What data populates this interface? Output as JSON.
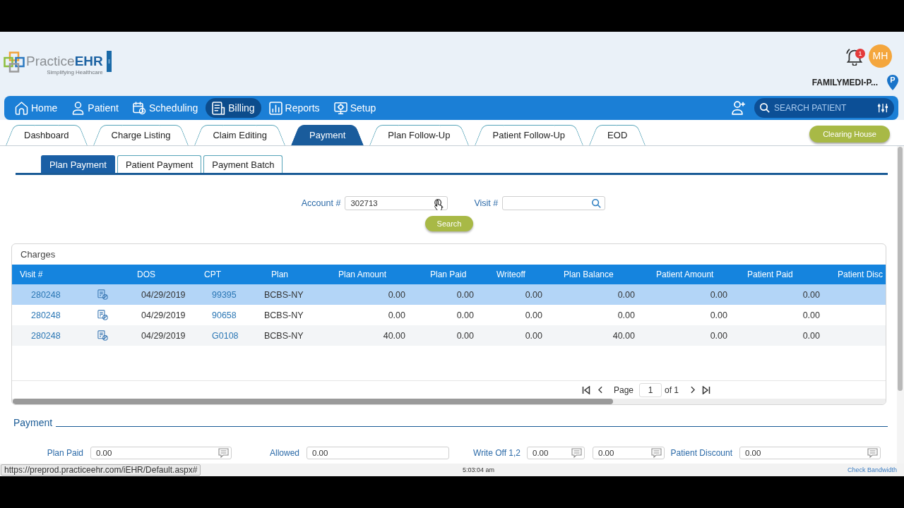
{
  "header": {
    "logo": {
      "wordmark": "Practice**EHR**",
      "tagline": "Simplifying Healthcare"
    },
    "notification_count": "1",
    "avatar": "MH",
    "practice": "FAMILYMEDI-P...",
    "location_badge": "P"
  },
  "nav": {
    "items": [
      {
        "label": "Home",
        "selected": false
      },
      {
        "label": "Patient",
        "selected": false
      },
      {
        "label": "Scheduling",
        "selected": false
      },
      {
        "label": "Billing",
        "selected": true
      },
      {
        "label": "Reports",
        "selected": false
      },
      {
        "label": "Setup",
        "selected": false
      }
    ],
    "search": {
      "placeholder": "SEARCH PATIENT"
    }
  },
  "tabs": [
    {
      "label": "Dashboard",
      "selected": false
    },
    {
      "label": "Charge Listing",
      "selected": false
    },
    {
      "label": "Claim Editing",
      "selected": false
    },
    {
      "label": "Payment",
      "selected": true
    },
    {
      "label": "Plan Follow-Up",
      "selected": false
    },
    {
      "label": "Patient Follow-Up",
      "selected": false
    },
    {
      "label": "EOD",
      "selected": false
    }
  ],
  "clearing_house_button": "Clearing House",
  "subtabs": [
    {
      "label": "Plan Payment",
      "selected": true
    },
    {
      "label": "Patient Payment",
      "selected": false
    },
    {
      "label": "Payment Batch",
      "selected": false
    }
  ],
  "search_form": {
    "fields": [
      {
        "label": "Account #",
        "value": "302713"
      },
      {
        "label": "Visit #"
      }
    ],
    "search_button": "Search"
  },
  "charges": {
    "title": "Charges",
    "columns": [
      "Visit #",
      "DOS",
      "CPT",
      "Plan",
      "Plan Amount",
      "Plan Paid",
      "Writeoff",
      "Plan Balance",
      "Patient Amount",
      "Patient Paid",
      "Patient Disc"
    ],
    "rows": [
      {
        "selected": true,
        "cells": [
          "280248",
          "04/29/2019",
          "99395",
          "BCBS-NY",
          "0.00",
          "0.00",
          "0.00",
          "0.00",
          "0.00",
          "0.00"
        ]
      },
      {
        "selected": false,
        "cells": [
          "280248",
          "04/29/2019",
          "90658",
          "BCBS-NY",
          "0.00",
          "0.00",
          "0.00",
          "0.00",
          "0.00",
          "0.00"
        ]
      },
      {
        "selected": false,
        "cells": [
          "280248",
          "04/29/2019",
          "G0108",
          "BCBS-NY",
          "40.00",
          "0.00",
          "0.00",
          "40.00",
          "0.00",
          "0.00"
        ]
      }
    ],
    "pagination": {
      "label": "Page",
      "page": "1",
      "total": "of 1"
    }
  },
  "payment": {
    "title": "Payment",
    "fields": [
      {
        "label": "Plan Paid",
        "inputs": [
          {
            "value": "0.00",
            "kind": "note"
          }
        ]
      },
      {
        "label": "Allowed",
        "inputs": [
          {
            "value": "0.00",
            "kind": "plain"
          }
        ]
      },
      {
        "label": "Write Off 1,2",
        "inputs": [
          {
            "value": "0.00",
            "kind": "note"
          },
          {
            "value": "0.00",
            "kind": "note"
          }
        ]
      },
      {
        "label": "Patient Discount",
        "inputs": [
          {
            "value": "0.00",
            "kind": "note"
          }
        ]
      }
    ]
  },
  "status_bar": {
    "url": "https://preprod.practiceehr.com/iEHR/Default.aspx#",
    "time": "5:03:04 am",
    "link": "Check Bandwidth"
  }
}
